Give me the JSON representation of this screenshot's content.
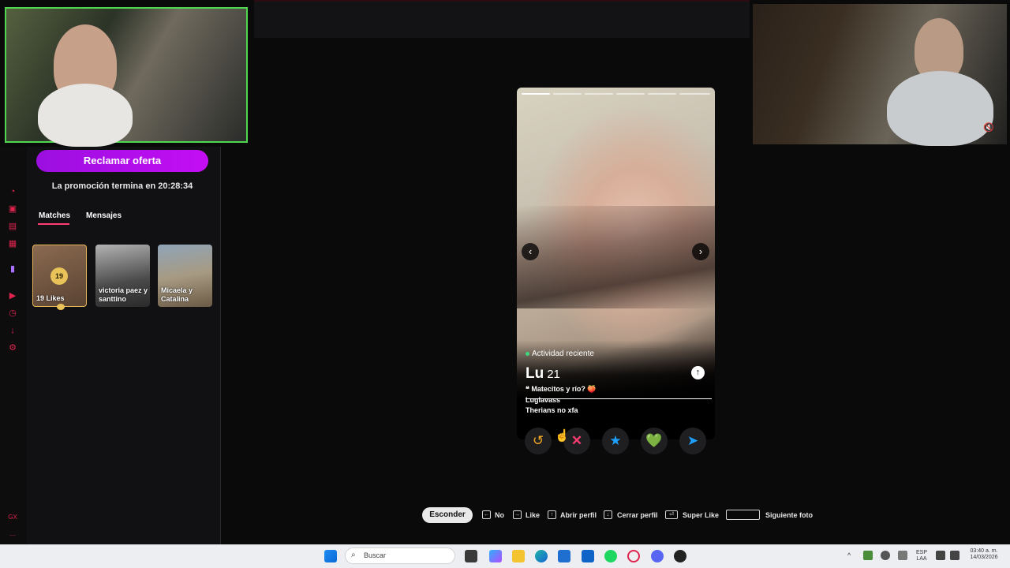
{
  "sidebar": {
    "claim_button": "Reclamar oferta",
    "promo_text": "La promoción termina en 20:28:34",
    "tabs": [
      "Matches",
      "Mensajes"
    ],
    "likes_count": "19",
    "thumbnails": [
      {
        "label": "19 Likes"
      },
      {
        "label": "victoria paez y santtino"
      },
      {
        "label": "Micaela y Catalina"
      }
    ]
  },
  "profile": {
    "activity": "Actividad reciente",
    "name": "Lu",
    "age": "21",
    "bio_line1": "Matecitos y río? 🍑",
    "bio_line2": "Luglavass",
    "bio_line3": "Therians no xfa",
    "photo_count": 6,
    "active_photo": 1
  },
  "actions": {
    "rewind_icon": "↺",
    "nope_icon": "✕",
    "superlike_icon": "★",
    "like_icon": "💚",
    "boost_icon": "➤"
  },
  "shortcuts": {
    "hide_button": "Esconder",
    "items": [
      {
        "key": "←",
        "label": "No"
      },
      {
        "key": "→",
        "label": "Like"
      },
      {
        "key": "↑",
        "label": "Abrir perfil"
      },
      {
        "key": "↓",
        "label": "Cerrar perfil"
      },
      {
        "key": "⏎",
        "label": "Super Like"
      }
    ],
    "space_label": "Siguiente foto"
  },
  "taskbar": {
    "search_placeholder": "Buscar",
    "lang": "ESP",
    "lang_sub": "LAA",
    "time": "03:40 a. m.",
    "date": "14/03/2026"
  },
  "colors": {
    "accent": "#fe3c72",
    "claim": "#b10ef0",
    "online": "#3fd77a"
  }
}
